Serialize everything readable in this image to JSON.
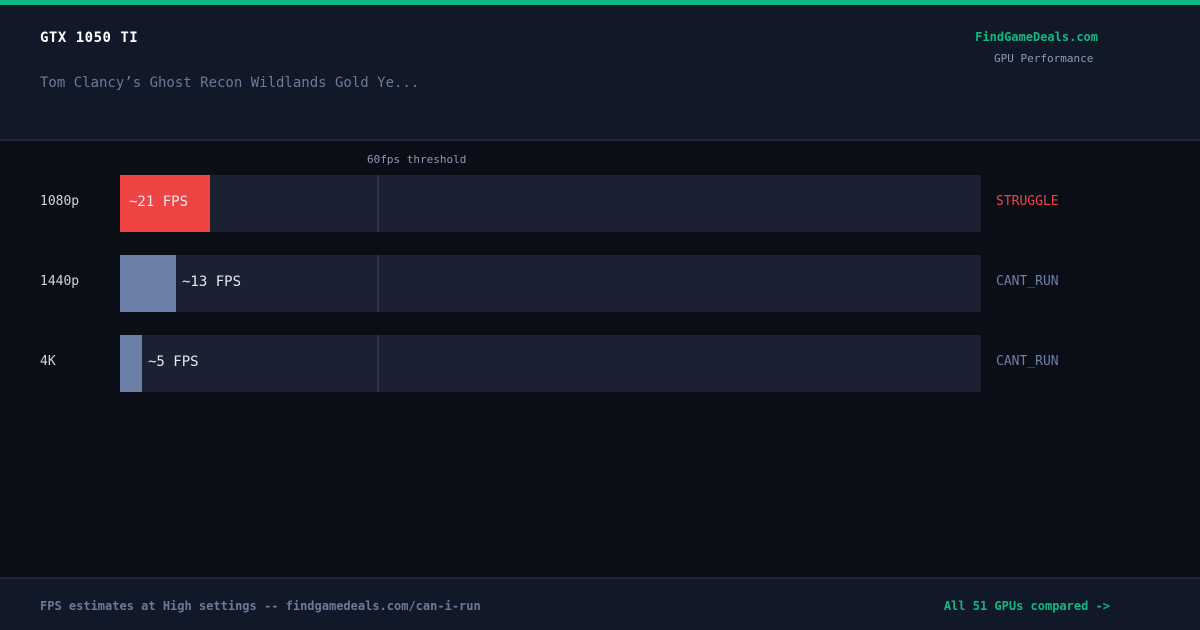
{
  "header": {
    "gpu": "GTX 1050 TI",
    "game": "Tom Clancy’s Ghost Recon Wildlands Gold Ye...",
    "brand": "FindGameDeals.com",
    "brand_sub": "GPU Performance"
  },
  "colors": {
    "accent": "#10b981",
    "struggle": "#ef4444",
    "cant_run": "#6b7fa8",
    "track": "#1b2133"
  },
  "chart_data": {
    "type": "bar",
    "orientation": "horizontal",
    "categories": [
      "1080p",
      "1440p",
      "4K"
    ],
    "values": [
      21,
      13,
      5
    ],
    "value_labels": [
      "~21 FPS",
      "~13 FPS",
      "~5 FPS"
    ],
    "statuses": [
      "STRUGGLE",
      "CANT_RUN",
      "CANT_RUN"
    ],
    "threshold": {
      "value": 60,
      "label": "60fps threshold"
    },
    "xlim": [
      0,
      200
    ],
    "grid": false
  },
  "footer": {
    "note": "FPS estimates at High settings -- findgamedeals.com/can-i-run",
    "link": "All 51 GPUs compared ->"
  }
}
